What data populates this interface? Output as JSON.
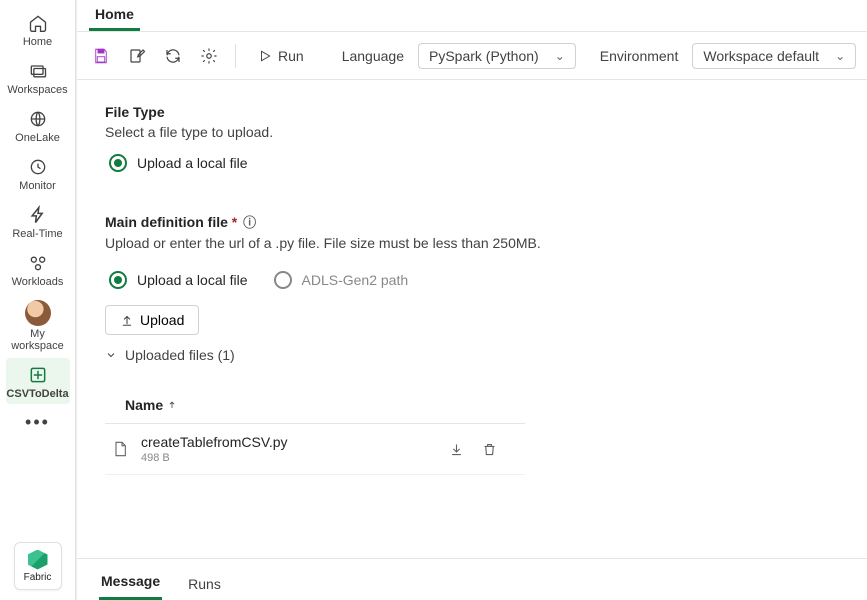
{
  "sidebar": {
    "items": [
      {
        "label": "Home",
        "icon": "home-icon"
      },
      {
        "label": "Workspaces",
        "icon": "workspaces-icon"
      },
      {
        "label": "OneLake",
        "icon": "onelake-icon"
      },
      {
        "label": "Monitor",
        "icon": "monitor-icon"
      },
      {
        "label": "Real-Time",
        "icon": "realtime-icon"
      },
      {
        "label": "Workloads",
        "icon": "workloads-icon"
      },
      {
        "label": "My workspace",
        "icon": "avatar"
      },
      {
        "label": "CSVToDelta",
        "icon": "spark-icon",
        "selected": true
      }
    ],
    "more_label": "...",
    "fabric_label": "Fabric"
  },
  "header": {
    "tab": "Home"
  },
  "toolbar": {
    "run_label": "Run",
    "language_label": "Language",
    "language_value": "PySpark (Python)",
    "environment_label": "Environment",
    "environment_value": "Workspace default"
  },
  "form": {
    "file_type_title": "File Type",
    "file_type_desc": "Select a file type to upload.",
    "file_type_option": "Upload a local file",
    "main_def_title": "Main definition file",
    "main_def_desc": "Upload or enter the url of a .py file. File size must be less than 250MB.",
    "main_def_opt1": "Upload a local file",
    "main_def_opt2": "ADLS-Gen2 path",
    "upload_btn": "Upload",
    "uploaded_files_label": "Uploaded files (1)",
    "table": {
      "col_name": "Name",
      "rows": [
        {
          "name": "createTablefromCSV.py",
          "size": "498 B"
        }
      ]
    }
  },
  "bottom": {
    "tabs": [
      {
        "label": "Message",
        "active": true
      },
      {
        "label": "Runs",
        "active": false
      }
    ]
  }
}
